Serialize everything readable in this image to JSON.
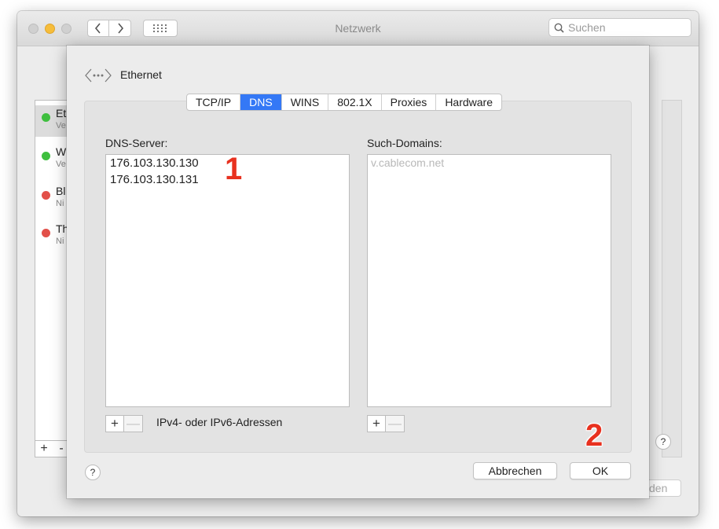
{
  "window": {
    "title": "Netzwerk",
    "search_placeholder": "Suchen"
  },
  "background": {
    "services": [
      {
        "name": "Et",
        "status": "Ve",
        "status_color": "#3fbf3f"
      },
      {
        "name": "W",
        "status": "Ve",
        "status_color": "#3fbf3f"
      },
      {
        "name": "Bl",
        "status": "Ni",
        "status_color": "#e25049"
      },
      {
        "name": "Th",
        "status": "Ni",
        "status_color": "#e25049"
      }
    ],
    "add_symbol": "+",
    "remove_symbol": "-",
    "help_symbol": "?",
    "apply_button_fragment": "den"
  },
  "sheet": {
    "interface_name": "Ethernet",
    "tabs": [
      "TCP/IP",
      "DNS",
      "WINS",
      "802.1X",
      "Proxies",
      "Hardware"
    ],
    "active_tab": "DNS",
    "dns_servers_label": "DNS-Server:",
    "dns_servers": [
      "176.103.130.130",
      "176.103.130.131"
    ],
    "search_domains_label": "Such-Domains:",
    "search_domains_placeholder": "v.cablecom.net",
    "add_symbol": "+",
    "remove_symbol": "—",
    "dns_hint": "IPv4- oder IPv6-Adressen",
    "help_symbol": "?",
    "cancel_label": "Abbrechen",
    "ok_label": "OK"
  },
  "annotations": {
    "marker_1": "1",
    "marker_2": "2"
  },
  "colors": {
    "accent": "#3478f6",
    "annotation": "#e8311f"
  }
}
